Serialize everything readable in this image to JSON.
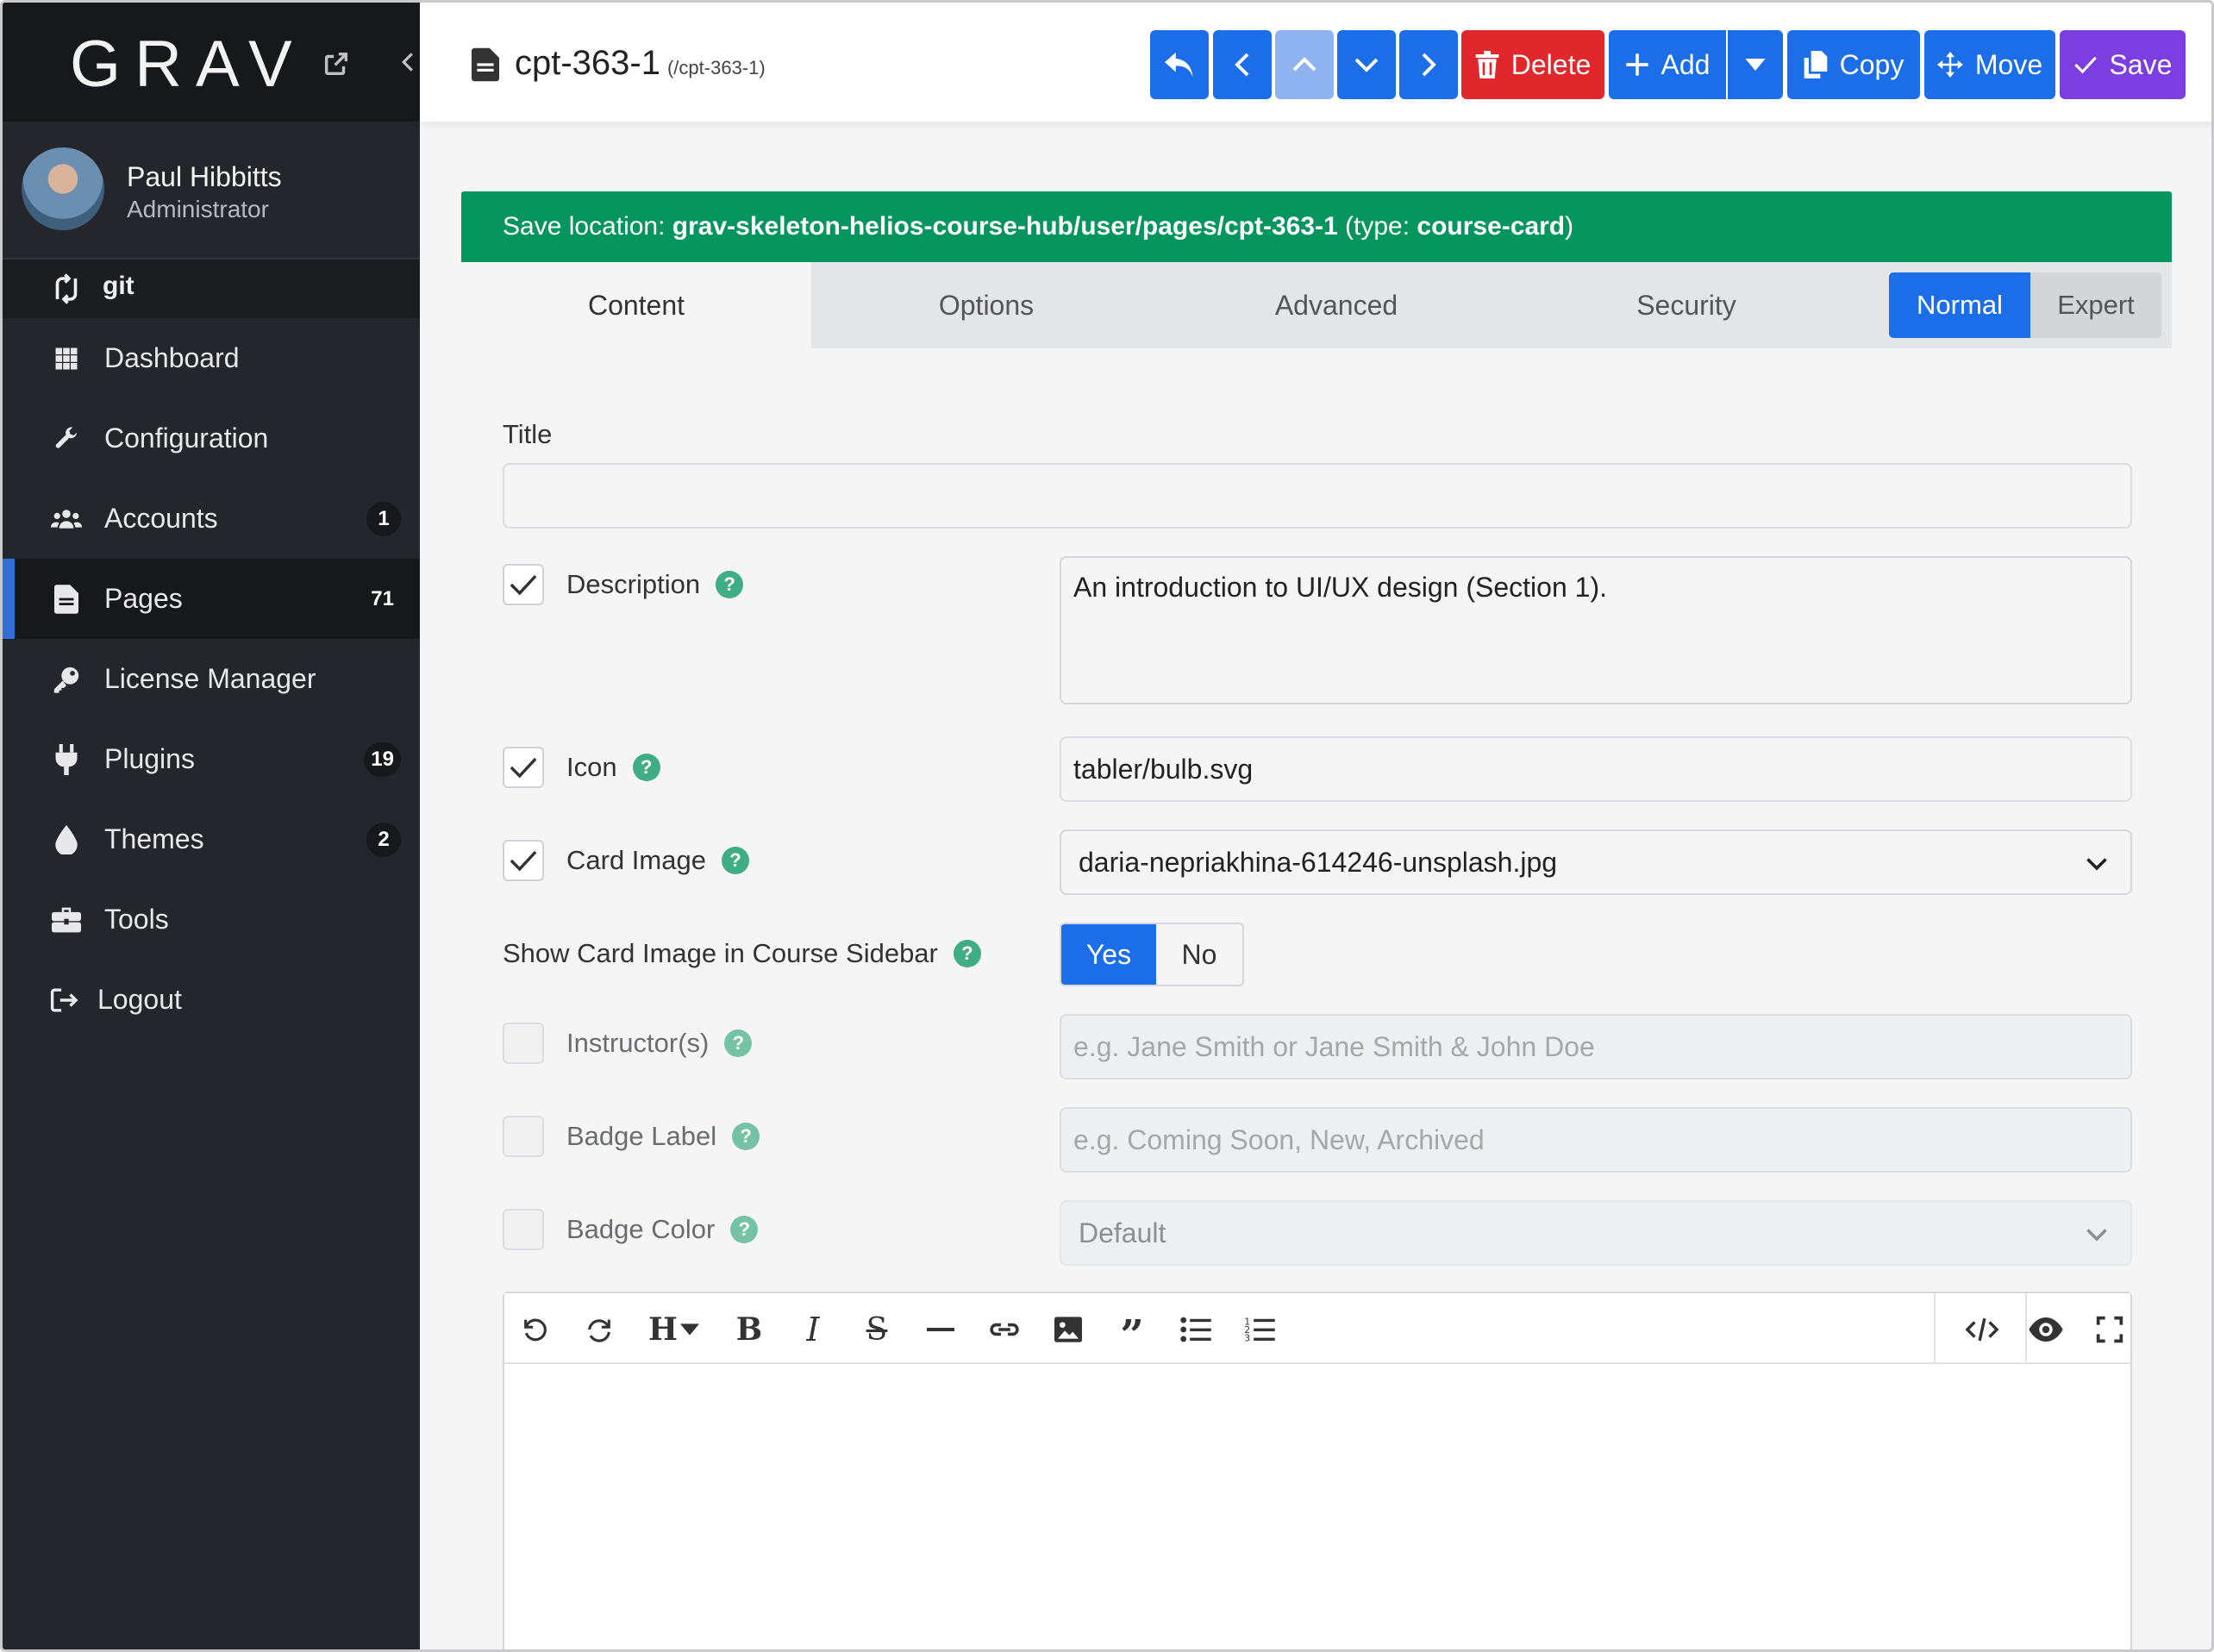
{
  "sidebar": {
    "logo": "GRAV",
    "user": {
      "name": "Paul Hibbitts",
      "role": "Administrator"
    },
    "git_label": "git",
    "items": [
      {
        "label": "Dashboard",
        "icon": "grid-icon",
        "badge": ""
      },
      {
        "label": "Configuration",
        "icon": "wrench-icon",
        "badge": ""
      },
      {
        "label": "Accounts",
        "icon": "users-icon",
        "badge": "1"
      },
      {
        "label": "Pages",
        "icon": "file-icon",
        "badge": "71",
        "active": true
      },
      {
        "label": "License Manager",
        "icon": "key-icon",
        "badge": ""
      },
      {
        "label": "Plugins",
        "icon": "plug-icon",
        "badge": "19"
      },
      {
        "label": "Themes",
        "icon": "droplet-icon",
        "badge": "2"
      },
      {
        "label": "Tools",
        "icon": "toolbox-icon",
        "badge": ""
      },
      {
        "label": "Logout",
        "icon": "logout-icon",
        "badge": ""
      }
    ]
  },
  "header": {
    "title": "cpt-363-1",
    "route": "(/cpt-363-1)",
    "buttons": {
      "delete": "Delete",
      "add": "Add",
      "copy": "Copy",
      "move": "Move",
      "save": "Save"
    }
  },
  "banner": {
    "prefix": "Save location: ",
    "path": "grav-skeleton-helios-course-hub/user/pages/cpt-363-1",
    "type_prefix": " (type: ",
    "type": "course-card",
    "suffix": ")"
  },
  "tabs": [
    "Content",
    "Options",
    "Advanced",
    "Security"
  ],
  "modes": {
    "normal": "Normal",
    "expert": "Expert"
  },
  "form": {
    "title_label": "Title",
    "title_value": "",
    "description_label": "Description",
    "description_value": "An introduction to UI/UX design (Section 1).",
    "icon_label": "Icon",
    "icon_value": "tabler/bulb.svg",
    "card_image_label": "Card Image",
    "card_image_value": "daria-nepriakhina-614246-unsplash.jpg",
    "show_card_label": "Show Card Image in Course Sidebar",
    "yes": "Yes",
    "no": "No",
    "instructors_label": "Instructor(s)",
    "instructors_placeholder": "e.g. Jane Smith or Jane Smith & John Doe",
    "badge_label_label": "Badge Label",
    "badge_label_placeholder": "e.g. Coming Soon, New, Archived",
    "badge_color_label": "Badge Color",
    "badge_color_value": "Default",
    "help": "?"
  },
  "colors": {
    "sidebar_bg": "#25262b",
    "accent_blue": "#1b6ee8",
    "banner_green": "#06955f",
    "delete_red": "#e0272b",
    "save_purple": "#7c3ee0",
    "help_green": "#3fae84"
  }
}
